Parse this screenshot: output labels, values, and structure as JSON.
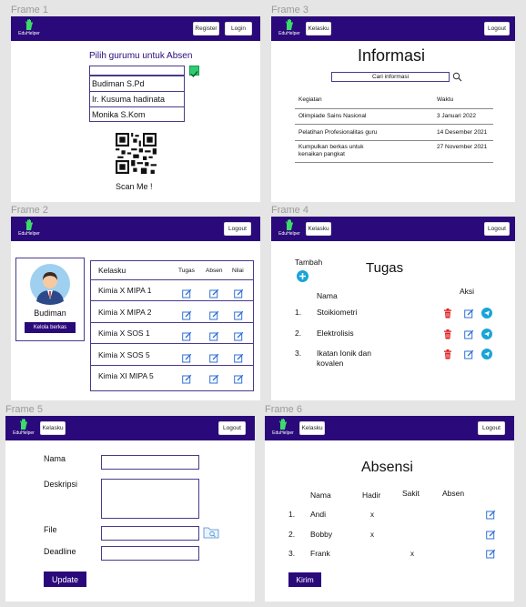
{
  "logo_text": "EduHelper",
  "frame1": {
    "label": "Frame 1",
    "register": "Register",
    "login": "Login",
    "heading": "Pilih gurumu untuk Absen",
    "options": [
      "Budiman S.Pd",
      "Ir. Kusuma hadinata",
      "Monika S.Kom"
    ],
    "scan": "Scan Me !"
  },
  "frame2": {
    "label": "Frame 2",
    "logout": "Logout",
    "name": "Budiman",
    "kelola": "Kelola berkas",
    "col_kelas": "Kelasku",
    "col_tugas": "Tugas",
    "col_absen": "Absen",
    "col_nilai": "Nilai",
    "rows": [
      "Kimia X MIPA 1",
      "Kimia X MIPA 2",
      "Kimia X SOS 1",
      "Kimia X SOS 5",
      "Kimia XI MIPA 5"
    ]
  },
  "frame3": {
    "label": "Frame 3",
    "kelasku": "Kelasku",
    "logout": "Logout",
    "title": "Informasi",
    "search_placeholder": "Cari informasi",
    "col_kegiatan": "Kegiatan",
    "col_waktu": "Waktu",
    "rows": [
      {
        "kegiatan": "Olimpiade Sains Nasional",
        "waktu": "3 Januari 2022"
      },
      {
        "kegiatan": "Pelatihan Profesionalitas guru",
        "waktu": "14 Desember 2021"
      },
      {
        "kegiatan": "Kumpulkan berkas untuk kenaikan pangkat",
        "waktu": "27 November 2021"
      }
    ]
  },
  "frame4": {
    "label": "Frame 4",
    "kelasku": "Kelasku",
    "logout": "Logout",
    "tambah": "Tambah",
    "title": "Tugas",
    "col_nama": "Nama",
    "col_aksi": "Aksi",
    "rows": [
      {
        "no": "1.",
        "nama": "Stoikiometri"
      },
      {
        "no": "2.",
        "nama": "Elektrolisis"
      },
      {
        "no": "3.",
        "nama": "Ikatan Ionik dan kovalen"
      }
    ]
  },
  "frame5": {
    "label": "Frame 5",
    "kelasku": "Kelasku",
    "logout": "Logout",
    "nama": "Nama",
    "deskripsi": "Deskripsi",
    "file": "File",
    "deadline": "Deadline",
    "update": "Update"
  },
  "frame6": {
    "label": "Frame 6",
    "kelasku": "Kelasku",
    "logout": "Logout",
    "title": "Absensi",
    "col_nama": "Nama",
    "col_hadir": "Hadir",
    "col_sakit": "Sakit",
    "col_absen": "Absen",
    "rows": [
      {
        "no": "1.",
        "nama": "Andi",
        "hadir": "x",
        "sakit": "",
        "absen": ""
      },
      {
        "no": "2.",
        "nama": "Bobby",
        "hadir": "x",
        "sakit": "",
        "absen": ""
      },
      {
        "no": "3.",
        "nama": "Frank",
        "hadir": "",
        "sakit": "x",
        "absen": ""
      }
    ],
    "kirim": "Kirim"
  },
  "colors": {
    "brand": "#2a0a7a",
    "edit": "#2f6fd6",
    "delete": "#e02020",
    "add": "#1aa4d8",
    "check": "#2ecc71"
  }
}
